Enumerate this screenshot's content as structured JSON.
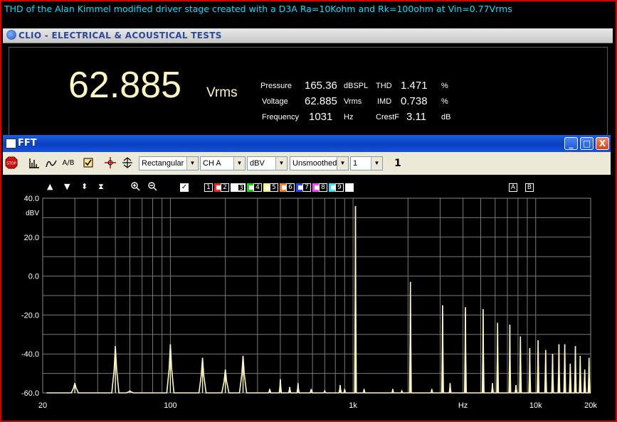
{
  "caption": "THD of the Alan Kimmel modified driver stage created with a D3A Ra=10Kohm and Rk=100ohm at Vin=0.77Vrms",
  "meter": {
    "window_title": "CLIO - ELECTRICAL & ACOUSTICAL TESTS",
    "big_value": "62.885",
    "big_unit": "Vrms",
    "rows": [
      {
        "label": "Pressure",
        "value": "165.36",
        "unit": "dBSPL",
        "label2": "THD",
        "value2": "1.471",
        "unit2": "%"
      },
      {
        "label": "Voltage",
        "value": "62.885",
        "unit": "Vrms",
        "label2": "IMD",
        "value2": "0.738",
        "unit2": "%"
      },
      {
        "label": "Frequency",
        "value": "1031",
        "unit": "Hz",
        "label2": "CrestF",
        "value2": "3.11",
        "unit2": "dB"
      }
    ]
  },
  "fft_window": {
    "title": "FFT",
    "minimize": "_",
    "maximize": "□",
    "close": "X"
  },
  "toolbar": {
    "stop_label": "STOP",
    "ab_label": "A/B",
    "window_select": "Rectangular",
    "channel_select": "CH A",
    "units_select": "dBV",
    "smoothing_select": "Unsmoothed",
    "averages_select": "1",
    "average_count": "1"
  },
  "memory_slots": [
    "1",
    "2",
    "3",
    "4",
    "5",
    "6",
    "7",
    "8",
    "9"
  ],
  "memory_colors": [
    "#ff2020",
    "#ffffff",
    "#20d020",
    "#fff080",
    "#ff8020",
    "#3040ff",
    "#ff40ff",
    "#40e0ff",
    "#ffffff"
  ],
  "ab_buttons": [
    "A",
    "B"
  ],
  "chart_data": {
    "type": "line",
    "xscale": "log",
    "xlim": [
      20,
      20000
    ],
    "ylim": [
      -60,
      40
    ],
    "yunit": "dBV",
    "y_ticks": [
      "40.0",
      "20.0",
      "0.0",
      "-20.0",
      "-40.0",
      "-60.0"
    ],
    "x_tick_labels": [
      {
        "value": 20,
        "label": "20"
      },
      {
        "value": 100,
        "label": "100"
      },
      {
        "value": 1000,
        "label": "1k"
      },
      {
        "value": 4000,
        "label": "Hz"
      },
      {
        "value": 10000,
        "label": "10k"
      },
      {
        "value": 20000,
        "label": "20k"
      }
    ],
    "line_color": "#fff7c0",
    "grid": true,
    "noise_floor": -60,
    "peaks": [
      {
        "f": 30,
        "db": -55
      },
      {
        "f": 50,
        "db": -36
      },
      {
        "f": 60,
        "db": -59
      },
      {
        "f": 100,
        "db": -35
      },
      {
        "f": 150,
        "db": -42
      },
      {
        "f": 200,
        "db": -48
      },
      {
        "f": 250,
        "db": -41
      },
      {
        "f": 350,
        "db": -58
      },
      {
        "f": 400,
        "db": -53
      },
      {
        "f": 450,
        "db": -57
      },
      {
        "f": 500,
        "db": -55
      },
      {
        "f": 590,
        "db": -58
      },
      {
        "f": 700,
        "db": -59
      },
      {
        "f": 850,
        "db": -56
      },
      {
        "f": 900,
        "db": -58
      },
      {
        "f": 1031,
        "db": 36
      },
      {
        "f": 1150,
        "db": -58
      },
      {
        "f": 1650,
        "db": -58
      },
      {
        "f": 1850,
        "db": -59
      },
      {
        "f": 2062,
        "db": -3
      },
      {
        "f": 2700,
        "db": -58
      },
      {
        "f": 3093,
        "db": -15
      },
      {
        "f": 3400,
        "db": -55
      },
      {
        "f": 4124,
        "db": -16
      },
      {
        "f": 5155,
        "db": -17
      },
      {
        "f": 5800,
        "db": -55
      },
      {
        "f": 6186,
        "db": -24
      },
      {
        "f": 7217,
        "db": -25
      },
      {
        "f": 7800,
        "db": -56
      },
      {
        "f": 8248,
        "db": -31
      },
      {
        "f": 9279,
        "db": -37
      },
      {
        "f": 10310,
        "db": -33
      },
      {
        "f": 11341,
        "db": -38
      },
      {
        "f": 12372,
        "db": -40
      },
      {
        "f": 13403,
        "db": -35
      },
      {
        "f": 14434,
        "db": -35
      },
      {
        "f": 15465,
        "db": -45
      },
      {
        "f": 16496,
        "db": -36
      },
      {
        "f": 17527,
        "db": -41
      },
      {
        "f": 18558,
        "db": -48
      },
      {
        "f": 19589,
        "db": -42
      }
    ]
  }
}
